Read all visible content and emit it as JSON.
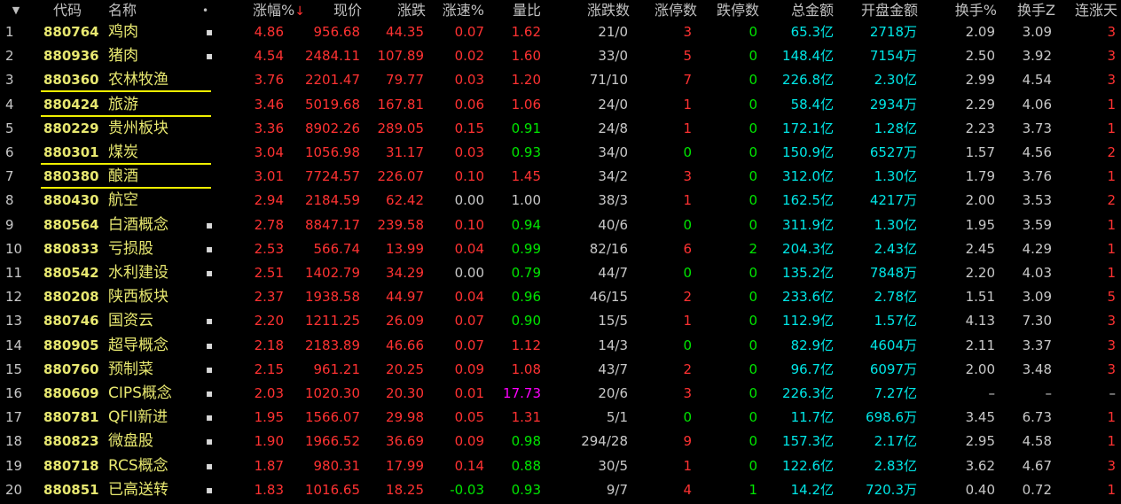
{
  "colors": {
    "up": "#ff3232",
    "down": "#00e600",
    "neutral": "#c8c8c8",
    "cyan": "#00e6e6",
    "yellow": "#e8e870",
    "magenta": "#ff00ff",
    "header": "#c0c0c0"
  },
  "header": {
    "menu_icon": "dropdown-triangle-icon",
    "code": "代码",
    "name": "名称",
    "mark": "•",
    "change_pct": "涨幅%",
    "sort_icon": "↓",
    "price": "现价",
    "change": "涨跌",
    "speed": "涨速%",
    "vol_ratio": "量比",
    "up_down_count": "涨跌数",
    "limit_up": "涨停数",
    "limit_down": "跌停数",
    "total_amount": "总金额",
    "open_amount": "开盘金额",
    "turnover": "换手%",
    "turnover_z": "换手Z",
    "consec_up": "连涨天"
  },
  "rows": [
    {
      "idx": "1",
      "code": "880764",
      "name": "鸡肉",
      "mark": "▪",
      "pct": "4.86",
      "price": "956.68",
      "chg": "44.35",
      "speed": "0.07",
      "speed_c": "up",
      "vr": "1.62",
      "vr_c": "up",
      "ud": "21/0",
      "lu": "3",
      "lu_c": "up",
      "ld": "0",
      "ld_c": "down",
      "amt": "65.3亿",
      "open": "2718万",
      "to": "2.09",
      "toz": "3.09",
      "cons": "3",
      "cons_c": "up",
      "ul": false
    },
    {
      "idx": "2",
      "code": "880936",
      "name": "猪肉",
      "mark": "▪",
      "pct": "4.54",
      "price": "2484.11",
      "chg": "107.89",
      "speed": "0.02",
      "speed_c": "up",
      "vr": "1.60",
      "vr_c": "up",
      "ud": "33/0",
      "lu": "5",
      "lu_c": "up",
      "ld": "0",
      "ld_c": "down",
      "amt": "148.4亿",
      "open": "7154万",
      "to": "2.50",
      "toz": "3.92",
      "cons": "3",
      "cons_c": "up",
      "ul": false
    },
    {
      "idx": "3",
      "code": "880360",
      "name": "农林牧渔",
      "mark": "",
      "pct": "3.76",
      "price": "2201.47",
      "chg": "79.77",
      "speed": "0.03",
      "speed_c": "up",
      "vr": "1.20",
      "vr_c": "up",
      "ud": "71/10",
      "lu": "7",
      "lu_c": "up",
      "ld": "0",
      "ld_c": "down",
      "amt": "226.8亿",
      "open": "2.30亿",
      "to": "2.99",
      "toz": "4.54",
      "cons": "3",
      "cons_c": "up",
      "ul": true
    },
    {
      "idx": "4",
      "code": "880424",
      "name": "旅游",
      "mark": "",
      "pct": "3.46",
      "price": "5019.68",
      "chg": "167.81",
      "speed": "0.06",
      "speed_c": "up",
      "vr": "1.06",
      "vr_c": "up",
      "ud": "24/0",
      "lu": "1",
      "lu_c": "up",
      "ld": "0",
      "ld_c": "down",
      "amt": "58.4亿",
      "open": "2934万",
      "to": "2.29",
      "toz": "4.06",
      "cons": "1",
      "cons_c": "up",
      "ul": true
    },
    {
      "idx": "5",
      "code": "880229",
      "name": "贵州板块",
      "mark": "",
      "pct": "3.36",
      "price": "8902.26",
      "chg": "289.05",
      "speed": "0.15",
      "speed_c": "up",
      "vr": "0.91",
      "vr_c": "down",
      "ud": "24/8",
      "lu": "1",
      "lu_c": "up",
      "ld": "0",
      "ld_c": "down",
      "amt": "172.1亿",
      "open": "1.28亿",
      "to": "2.23",
      "toz": "3.73",
      "cons": "1",
      "cons_c": "up",
      "ul": false
    },
    {
      "idx": "6",
      "code": "880301",
      "name": "煤炭",
      "mark": "",
      "pct": "3.04",
      "price": "1056.98",
      "chg": "31.17",
      "speed": "0.03",
      "speed_c": "up",
      "vr": "0.93",
      "vr_c": "down",
      "ud": "34/0",
      "lu": "0",
      "lu_c": "down",
      "ld": "0",
      "ld_c": "down",
      "amt": "150.9亿",
      "open": "6527万",
      "to": "1.57",
      "toz": "4.56",
      "cons": "2",
      "cons_c": "up",
      "ul": true
    },
    {
      "idx": "7",
      "code": "880380",
      "name": "酿酒",
      "mark": "",
      "pct": "3.01",
      "price": "7724.57",
      "chg": "226.07",
      "speed": "0.10",
      "speed_c": "up",
      "vr": "1.45",
      "vr_c": "up",
      "ud": "34/2",
      "lu": "3",
      "lu_c": "up",
      "ld": "0",
      "ld_c": "down",
      "amt": "312.0亿",
      "open": "1.30亿",
      "to": "1.79",
      "toz": "3.76",
      "cons": "1",
      "cons_c": "up",
      "ul": true
    },
    {
      "idx": "8",
      "code": "880430",
      "name": "航空",
      "mark": "",
      "pct": "2.94",
      "price": "2184.59",
      "chg": "62.42",
      "speed": "0.00",
      "speed_c": "neutral",
      "vr": "1.00",
      "vr_c": "neutral",
      "ud": "38/3",
      "lu": "1",
      "lu_c": "up",
      "ld": "0",
      "ld_c": "down",
      "amt": "162.5亿",
      "open": "4217万",
      "to": "2.00",
      "toz": "3.53",
      "cons": "2",
      "cons_c": "up",
      "ul": false
    },
    {
      "idx": "9",
      "code": "880564",
      "name": "白酒概念",
      "mark": "▪",
      "pct": "2.78",
      "price": "8847.17",
      "chg": "239.58",
      "speed": "0.10",
      "speed_c": "up",
      "vr": "0.94",
      "vr_c": "down",
      "ud": "40/6",
      "lu": "0",
      "lu_c": "down",
      "ld": "0",
      "ld_c": "down",
      "amt": "311.9亿",
      "open": "1.30亿",
      "to": "1.95",
      "toz": "3.59",
      "cons": "1",
      "cons_c": "up",
      "ul": false
    },
    {
      "idx": "10",
      "code": "880833",
      "name": "亏损股",
      "mark": "▪",
      "pct": "2.53",
      "price": "566.74",
      "chg": "13.99",
      "speed": "0.04",
      "speed_c": "up",
      "vr": "0.99",
      "vr_c": "down",
      "ud": "82/16",
      "lu": "6",
      "lu_c": "up",
      "ld": "2",
      "ld_c": "down",
      "amt": "204.3亿",
      "open": "2.43亿",
      "to": "2.45",
      "toz": "4.29",
      "cons": "1",
      "cons_c": "up",
      "ul": false
    },
    {
      "idx": "11",
      "code": "880542",
      "name": "水利建设",
      "mark": "▪",
      "pct": "2.51",
      "price": "1402.79",
      "chg": "34.29",
      "speed": "0.00",
      "speed_c": "neutral",
      "vr": "0.79",
      "vr_c": "down",
      "ud": "44/7",
      "lu": "0",
      "lu_c": "down",
      "ld": "0",
      "ld_c": "down",
      "amt": "135.2亿",
      "open": "7848万",
      "to": "2.20",
      "toz": "4.03",
      "cons": "1",
      "cons_c": "up",
      "ul": false
    },
    {
      "idx": "12",
      "code": "880208",
      "name": "陕西板块",
      "mark": "",
      "pct": "2.37",
      "price": "1938.58",
      "chg": "44.97",
      "speed": "0.04",
      "speed_c": "up",
      "vr": "0.96",
      "vr_c": "down",
      "ud": "46/15",
      "lu": "2",
      "lu_c": "up",
      "ld": "0",
      "ld_c": "down",
      "amt": "233.6亿",
      "open": "2.78亿",
      "to": "1.51",
      "toz": "3.09",
      "cons": "5",
      "cons_c": "up",
      "ul": false
    },
    {
      "idx": "13",
      "code": "880746",
      "name": "国资云",
      "mark": "▪",
      "pct": "2.20",
      "price": "1211.25",
      "chg": "26.09",
      "speed": "0.07",
      "speed_c": "up",
      "vr": "0.90",
      "vr_c": "down",
      "ud": "15/5",
      "lu": "1",
      "lu_c": "up",
      "ld": "0",
      "ld_c": "down",
      "amt": "112.9亿",
      "open": "1.57亿",
      "to": "4.13",
      "toz": "7.30",
      "cons": "3",
      "cons_c": "up",
      "ul": false
    },
    {
      "idx": "14",
      "code": "880905",
      "name": "超导概念",
      "mark": "▪",
      "pct": "2.18",
      "price": "2183.89",
      "chg": "46.66",
      "speed": "0.07",
      "speed_c": "up",
      "vr": "1.12",
      "vr_c": "up",
      "ud": "14/3",
      "lu": "0",
      "lu_c": "down",
      "ld": "0",
      "ld_c": "down",
      "amt": "82.9亿",
      "open": "4604万",
      "to": "2.11",
      "toz": "3.37",
      "cons": "3",
      "cons_c": "up",
      "ul": false
    },
    {
      "idx": "15",
      "code": "880760",
      "name": "预制菜",
      "mark": "▪",
      "pct": "2.15",
      "price": "961.21",
      "chg": "20.25",
      "speed": "0.09",
      "speed_c": "up",
      "vr": "1.08",
      "vr_c": "up",
      "ud": "43/7",
      "lu": "2",
      "lu_c": "up",
      "ld": "0",
      "ld_c": "down",
      "amt": "96.7亿",
      "open": "6097万",
      "to": "2.00",
      "toz": "3.48",
      "cons": "3",
      "cons_c": "up",
      "ul": false
    },
    {
      "idx": "16",
      "code": "880609",
      "name": "CIPS概念",
      "mark": "▪",
      "pct": "2.03",
      "price": "1020.30",
      "chg": "20.30",
      "speed": "0.01",
      "speed_c": "up",
      "vr": "17.73",
      "vr_c": "magenta",
      "ud": "20/6",
      "lu": "3",
      "lu_c": "up",
      "ld": "0",
      "ld_c": "down",
      "amt": "226.3亿",
      "open": "7.27亿",
      "to": "–",
      "toz": "–",
      "cons": "–",
      "cons_c": "neutral",
      "ul": false
    },
    {
      "idx": "17",
      "code": "880781",
      "name": "QFII新进",
      "mark": "▪",
      "pct": "1.95",
      "price": "1566.07",
      "chg": "29.98",
      "speed": "0.05",
      "speed_c": "up",
      "vr": "1.31",
      "vr_c": "up",
      "ud": "5/1",
      "lu": "0",
      "lu_c": "down",
      "ld": "0",
      "ld_c": "down",
      "amt": "11.7亿",
      "open": "698.6万",
      "to": "3.45",
      "toz": "6.73",
      "cons": "1",
      "cons_c": "up",
      "ul": false
    },
    {
      "idx": "18",
      "code": "880823",
      "name": "微盘股",
      "mark": "▪",
      "pct": "1.90",
      "price": "1966.52",
      "chg": "36.69",
      "speed": "0.09",
      "speed_c": "up",
      "vr": "0.98",
      "vr_c": "down",
      "ud": "294/28",
      "lu": "9",
      "lu_c": "up",
      "ld": "0",
      "ld_c": "down",
      "amt": "157.3亿",
      "open": "2.17亿",
      "to": "2.95",
      "toz": "4.58",
      "cons": "1",
      "cons_c": "up",
      "ul": false
    },
    {
      "idx": "19",
      "code": "880718",
      "name": "RCS概念",
      "mark": "▪",
      "pct": "1.87",
      "price": "980.31",
      "chg": "17.99",
      "speed": "0.14",
      "speed_c": "up",
      "vr": "0.88",
      "vr_c": "down",
      "ud": "30/5",
      "lu": "1",
      "lu_c": "up",
      "ld": "0",
      "ld_c": "down",
      "amt": "122.6亿",
      "open": "2.83亿",
      "to": "3.62",
      "toz": "4.67",
      "cons": "3",
      "cons_c": "up",
      "ul": false
    },
    {
      "idx": "20",
      "code": "880851",
      "name": "已高送转",
      "mark": "▪",
      "pct": "1.83",
      "price": "1016.65",
      "chg": "18.25",
      "speed": "-0.03",
      "speed_c": "down",
      "vr": "0.93",
      "vr_c": "down",
      "ud": "9/7",
      "lu": "4",
      "lu_c": "up",
      "ld": "1",
      "ld_c": "down",
      "amt": "14.2亿",
      "open": "720.3万",
      "to": "0.40",
      "toz": "0.72",
      "cons": "1",
      "cons_c": "up",
      "ul": false
    }
  ]
}
